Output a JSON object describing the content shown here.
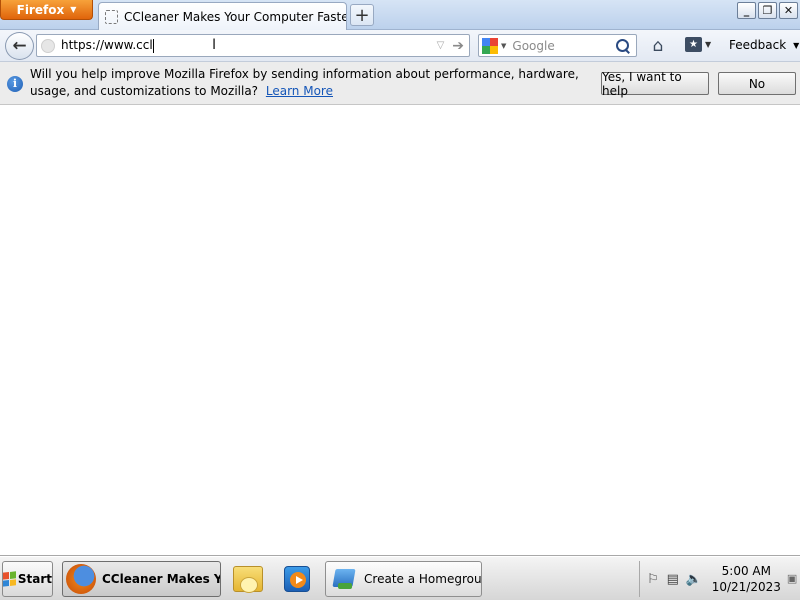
{
  "browser": {
    "menu_label": "Firefox",
    "tab": {
      "title": "CCleaner Makes Your Computer Faster ..."
    },
    "new_tab_symbol": "+",
    "window_controls": {
      "minimize": "▁",
      "restore": "🗗",
      "close": "✕"
    }
  },
  "navbar": {
    "back_symbol": "🡐",
    "url": "https://www.ccl",
    "search_placeholder": "Google",
    "home_symbol": "⌂",
    "feedback_label": "Feedback"
  },
  "notification": {
    "message": "Will you help improve Mozilla Firefox by sending information about performance, hardware, usage, and customizations to Mozilla?",
    "learn_more": "Learn More",
    "yes_button": "Yes, I want to help",
    "no_button": "No"
  },
  "taskbar": {
    "start_label": "Start",
    "tasks": [
      {
        "label": "CCleaner Makes Yo...",
        "icon": "firefox-icon"
      },
      {
        "label": "",
        "icon": "folder-icon"
      },
      {
        "label": "",
        "icon": "media-player-icon"
      },
      {
        "label": "Create a Homegroup",
        "icon": "homegroup-icon"
      }
    ],
    "clock": {
      "time": "5:00 AM",
      "date": "10/21/2023"
    }
  },
  "colors": {
    "firefox_orange": "#e0640b",
    "link_blue": "#1556b8"
  }
}
